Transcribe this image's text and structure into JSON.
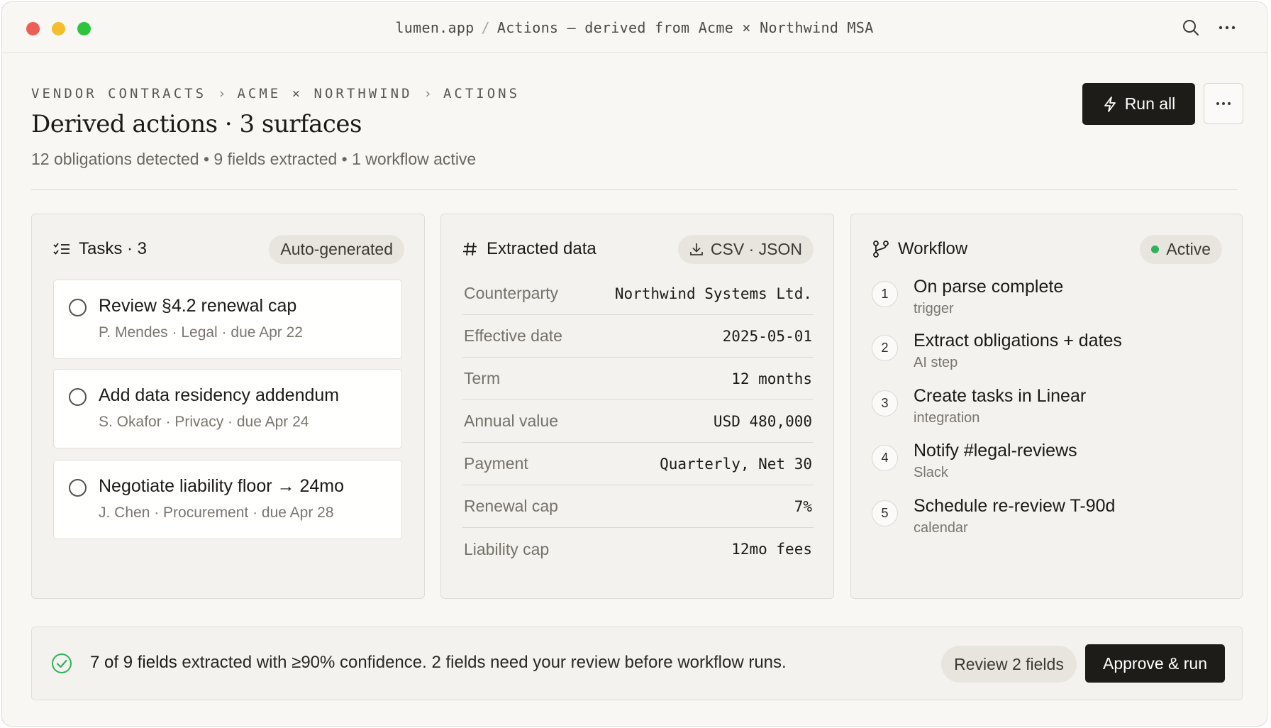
{
  "window": {
    "url_host": "lumen.app",
    "url_path": "Actions — derived from Acme × Northwind MSA"
  },
  "header": {
    "breadcrumb": [
      "VENDOR CONTRACTS",
      "ACME × NORTHWIND",
      "ACTIONS"
    ],
    "title": "Derived actions · 3 surfaces",
    "summary": "12 obligations detected • 9 fields extracted • 1 workflow active",
    "run_all_label": "Run all"
  },
  "tasks_card": {
    "title": "Tasks · 3",
    "badge": "Auto-generated",
    "tasks": [
      {
        "title": "Review §4.2 renewal cap",
        "meta": "P. Mendes · Legal · due Apr 22"
      },
      {
        "title": "Add data residency addendum",
        "meta": "S. Okafor · Privacy · due Apr 24"
      },
      {
        "title": "Negotiate liability floor → 24mo",
        "meta": "J. Chen · Procurement · due Apr 28"
      }
    ]
  },
  "data_card": {
    "title": "Extracted data",
    "export_label": "CSV · JSON",
    "fields": [
      {
        "key": "Counterparty",
        "value": "Northwind Systems Ltd."
      },
      {
        "key": "Effective date",
        "value": "2025-05-01"
      },
      {
        "key": "Term",
        "value": "12 months"
      },
      {
        "key": "Annual value",
        "value": "USD 480,000"
      },
      {
        "key": "Payment",
        "value": "Quarterly, Net 30"
      },
      {
        "key": "Renewal cap",
        "value": "7%"
      },
      {
        "key": "Liability cap",
        "value": "12mo fees"
      }
    ]
  },
  "workflow_card": {
    "title": "Workflow",
    "status": "Active",
    "status_color": "#2fb35a",
    "steps": [
      {
        "num": "1",
        "title": "On parse complete",
        "sub": "trigger"
      },
      {
        "num": "2",
        "title": "Extract obligations + dates",
        "sub": "AI step"
      },
      {
        "num": "3",
        "title": "Create tasks in Linear",
        "sub": "integration"
      },
      {
        "num": "4",
        "title": "Notify #legal-reviews",
        "sub": "Slack"
      },
      {
        "num": "5",
        "title": "Schedule re-review T-90d",
        "sub": "calendar"
      }
    ]
  },
  "footer": {
    "message_strong": "7 of 9 fields",
    "message_rest": " extracted with ≥90% confidence. 2 fields need your review before workflow runs.",
    "review_label": "Review 2 fields",
    "approve_label": "Approve & run"
  },
  "colors": {
    "accent_dark": "#1e1c19",
    "success": "#2fb35a",
    "background": "#f8f7f4"
  }
}
